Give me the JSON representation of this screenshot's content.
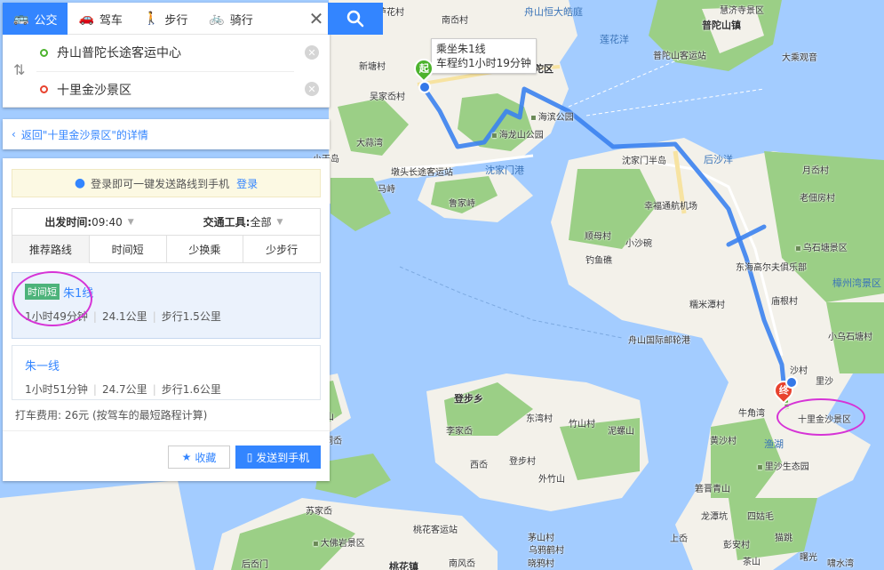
{
  "modes": [
    {
      "label": "公交",
      "icon": "bus-icon",
      "active": true
    },
    {
      "label": "驾车",
      "icon": "car-icon",
      "active": false
    },
    {
      "label": "步行",
      "icon": "walk-icon",
      "active": false
    },
    {
      "label": "骑行",
      "icon": "bike-icon",
      "active": false
    }
  ],
  "od": {
    "from": "舟山普陀长途客运中心",
    "to": "十里金沙景区"
  },
  "back_link": "返回\"十里金沙景区\"的详情",
  "login_tip": {
    "text": "登录即可一键发送路线到手机",
    "link": "登录"
  },
  "filters": {
    "depart_label": "出发时间:",
    "depart_value": "09:40",
    "tool_label": "交通工具:",
    "tool_value": "全部",
    "prefs": [
      "推荐路线",
      "时间短",
      "少换乘",
      "少步行"
    ]
  },
  "routes": [
    {
      "badge": "时间短",
      "name": "朱1线",
      "duration": "1小时49分钟",
      "distance": "24.1公里",
      "walk": "步行1.5公里"
    },
    {
      "badge": "",
      "name": "朱一线",
      "duration": "1小时51分钟",
      "distance": "24.7公里",
      "walk": "步行1.6公里"
    }
  ],
  "taxi_fare": "打车费用: 26元 (按驾车的最短路程计算)",
  "actions": {
    "fav": "收藏",
    "send": "发送到手机"
  },
  "bubble": {
    "line1": "乘坐朱1线",
    "line2": "车程约1小时19分钟"
  },
  "markers": {
    "start": "起",
    "end": "终"
  },
  "map_labels": {
    "l01": "芦花村",
    "l02": "南岙村",
    "l03": "舟山恒大皓庭",
    "l04": "慧济寺景区",
    "l05": "普陀山镇",
    "l06": "莲花洋",
    "l07": "普陀山客运站",
    "l08": "大乘观音",
    "l09": "普陀区",
    "l10": "新塘村",
    "l11": "吴家岙村",
    "l12": "海滨公园",
    "l13": "海龙山公园",
    "l14": "大蒜湾",
    "l15": "小干岛",
    "l16": "墩头长途客运站",
    "l17": "沈家门港",
    "l18": "马峙",
    "l19": "鲁家峙",
    "l20": "沈家门半岛",
    "l21": "后沙洋",
    "l22": "月岙村",
    "l23": "老佃房村",
    "l24": "幸福通航机场",
    "l25": "顺母村",
    "l26": "小沙碗",
    "l27": "钓鱼礁",
    "l28": "乌石塘景区",
    "l29": "东海高尔夫俱乐部",
    "l30": "樟州湾景区",
    "l31": "庙根村",
    "l32": "糯米潭村",
    "l33": "舟山国际邮轮港",
    "l34": "小乌石塘村",
    "l35": "沙村",
    "l36": "里沙",
    "l37": "牛角湾",
    "l38": "十里金沙景区",
    "l39": "黄沙村",
    "l40": "渔湖",
    "l41": "里沙生态园",
    "l42": "登步乡",
    "l43": "李家岙",
    "l44": "东湾村",
    "l45": "竹山村",
    "l46": "泥螺山",
    "l47": "西岙",
    "l48": "登步村",
    "l49": "外竹山",
    "l50": "八洞岙",
    "l51": "石峰山",
    "l52": "苏家岙",
    "l53": "箬晋青山",
    "l54": "龙潭坑",
    "l55": "四姑毛",
    "l56": "上岙",
    "l57": "猫跳",
    "l58": "彭安村",
    "l59": "桃花客运站",
    "l60": "桃花镇",
    "l61": "大佛岩景区",
    "l62": "后岙门",
    "l63": "南风岙",
    "l64": "乌鸦鹤村",
    "l65": "晓鸦村",
    "l66": "茅山村",
    "l67": "茶山",
    "l68": "曙光",
    "l69": "啸水湾"
  },
  "colors": {
    "accent": "#3385ff",
    "route": "#3b82f0",
    "land": "#f3f1ea",
    "green": "#9bcf86",
    "water": "#a3ccff"
  }
}
